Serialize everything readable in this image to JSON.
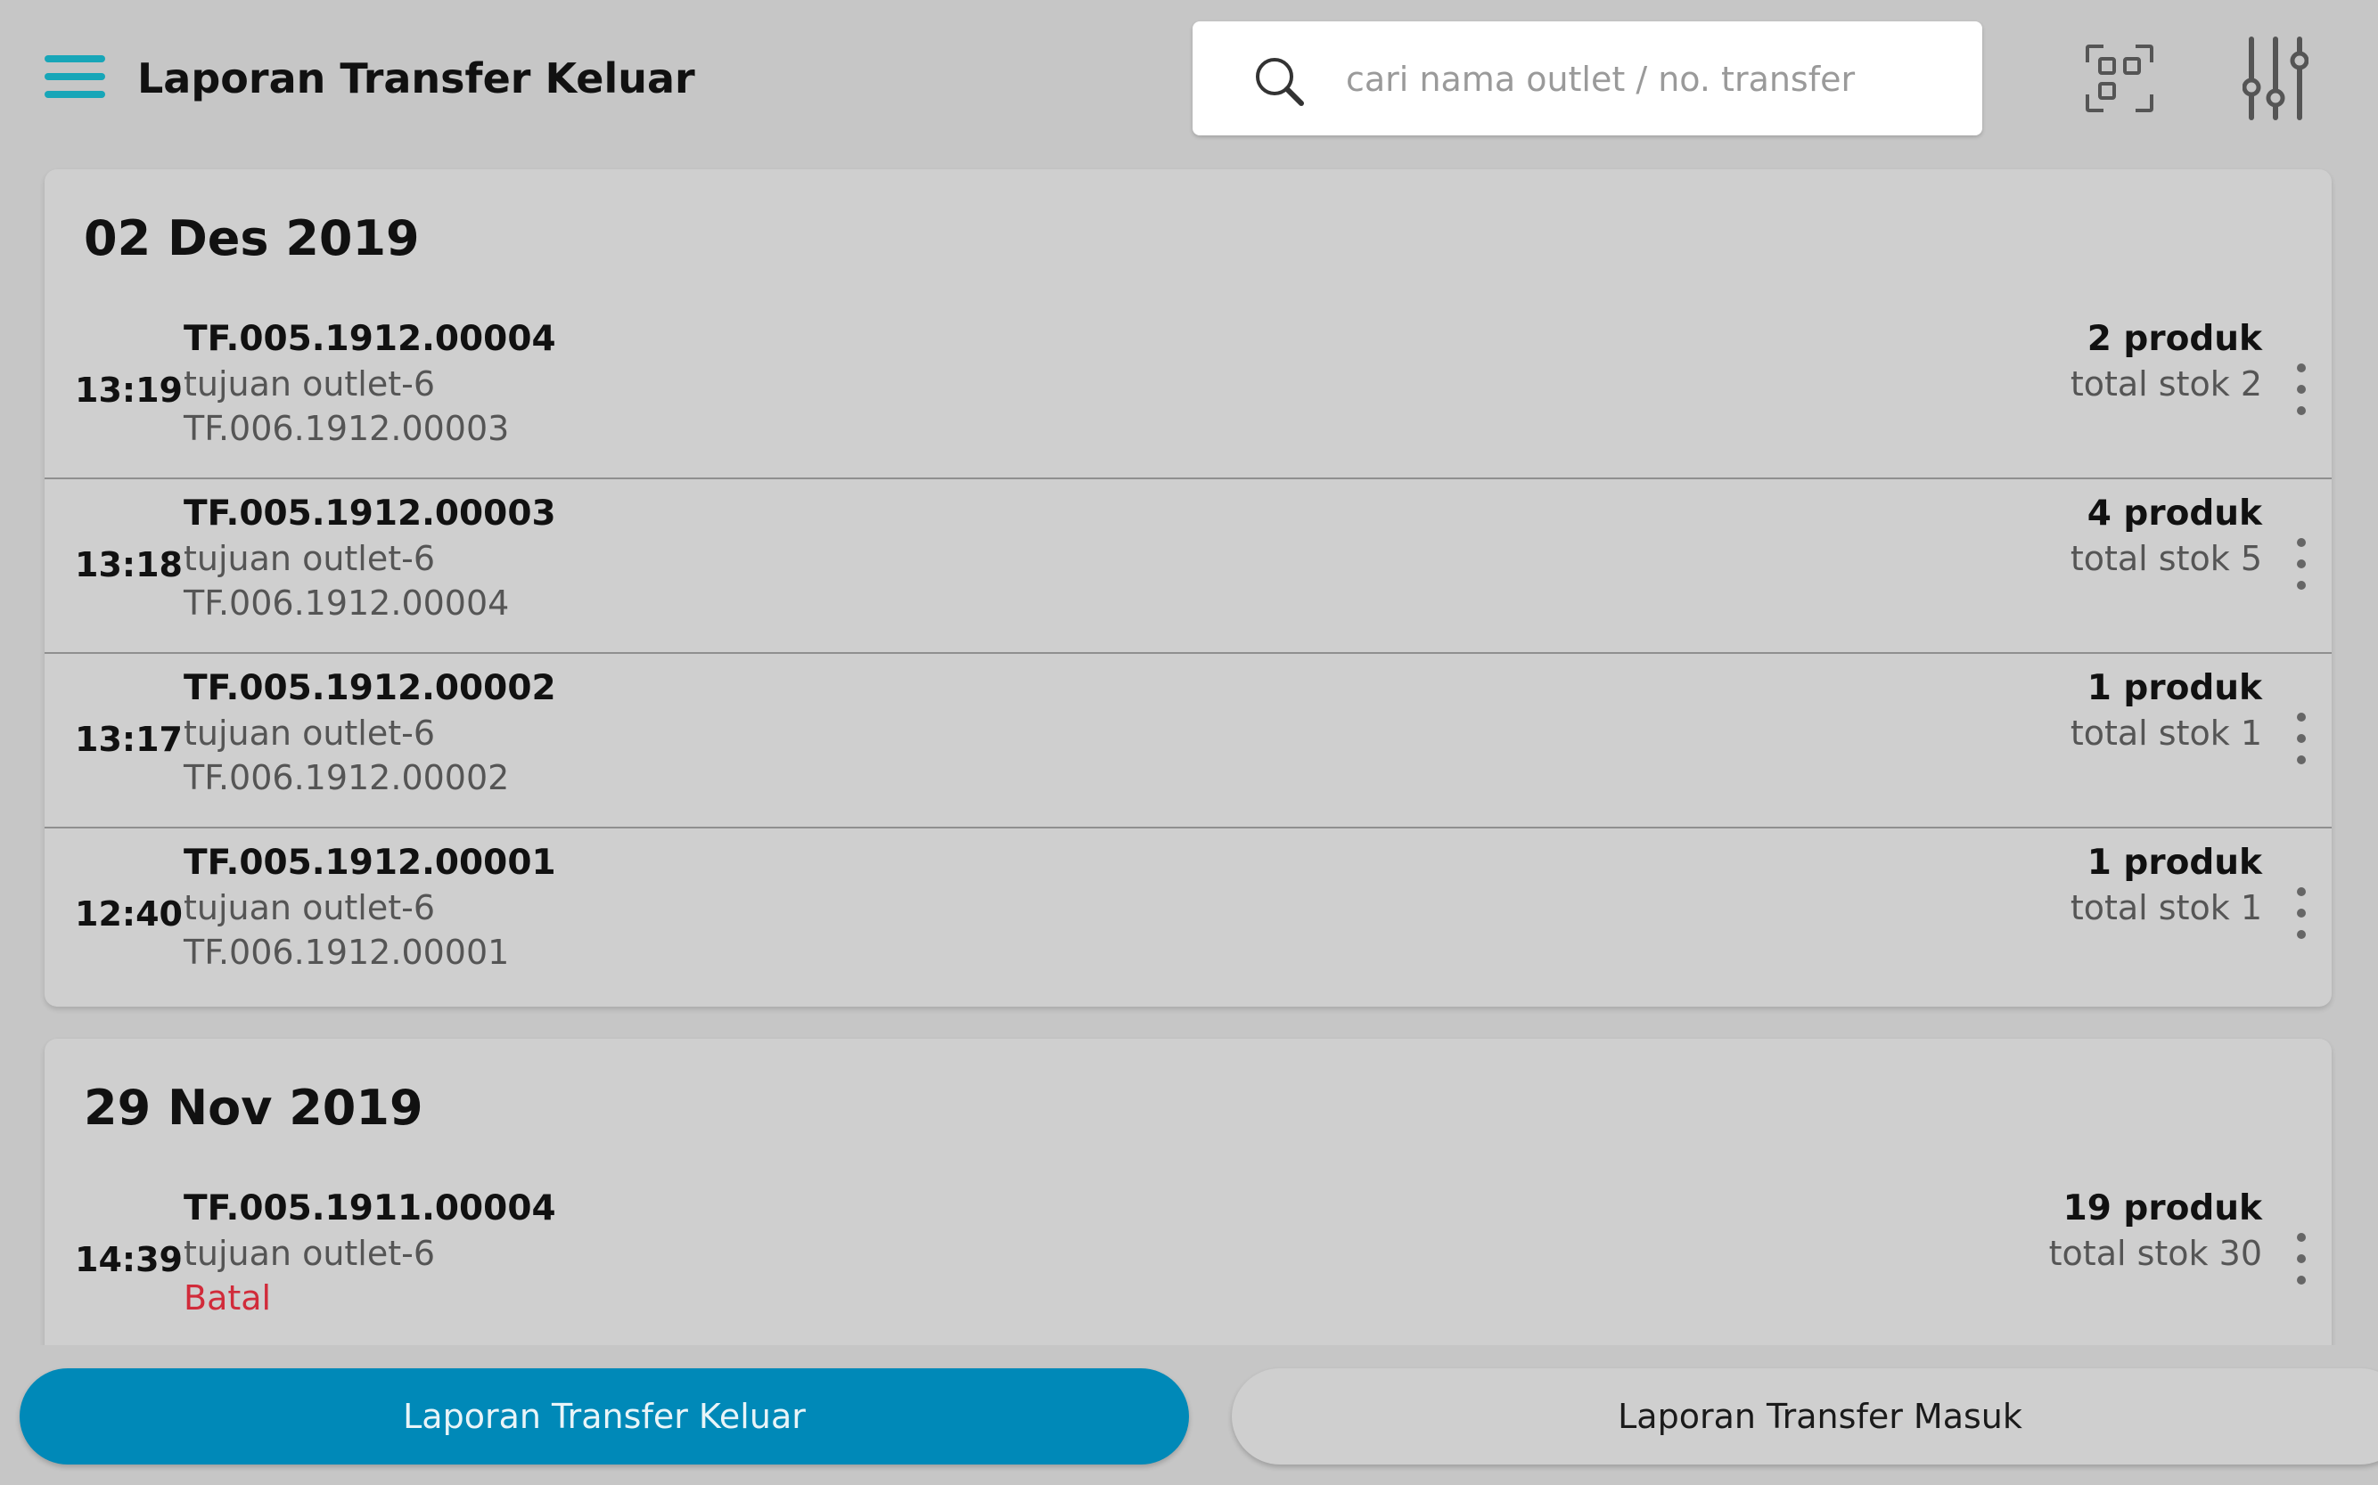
{
  "header": {
    "title": "Laporan Transfer Keluar",
    "search_placeholder": "cari nama outlet / no. transfer",
    "search_value": ""
  },
  "icons": {
    "menu": "hamburger-menu-icon",
    "search": "search-icon",
    "scan": "qr-scan-icon",
    "filter": "filter-sliders-icon",
    "more": "more-vertical-icon"
  },
  "colors": {
    "accent": "#17a6b8",
    "active_tab": "#0089b8",
    "cancelled": "#d12b3a"
  },
  "groups": [
    {
      "date": "02 Des 2019",
      "items": [
        {
          "time": "13:19",
          "id": "TF.005.1912.00004",
          "destination": "tujuan outlet-6",
          "ref": "TF.006.1912.00003",
          "products": "2 produk",
          "stock": "total stok 2"
        },
        {
          "time": "13:18",
          "id": "TF.005.1912.00003",
          "destination": "tujuan outlet-6",
          "ref": "TF.006.1912.00004",
          "products": "4 produk",
          "stock": "total stok 5"
        },
        {
          "time": "13:17",
          "id": "TF.005.1912.00002",
          "destination": "tujuan outlet-6",
          "ref": "TF.006.1912.00002",
          "products": "1 produk",
          "stock": "total stok 1"
        },
        {
          "time": "12:40",
          "id": "TF.005.1912.00001",
          "destination": "tujuan outlet-6",
          "ref": "TF.006.1912.00001",
          "products": "1 produk",
          "stock": "total stok 1"
        }
      ]
    },
    {
      "date": "29 Nov 2019",
      "items": [
        {
          "time": "14:39",
          "id": "TF.005.1911.00004",
          "destination": "tujuan outlet-6",
          "ref": "Batal",
          "products": "19 produk",
          "stock": "total stok 30"
        }
      ]
    }
  ],
  "tabs": [
    {
      "label": "Laporan Transfer Keluar",
      "active": true
    },
    {
      "label": "Laporan Transfer Masuk",
      "active": false
    }
  ]
}
